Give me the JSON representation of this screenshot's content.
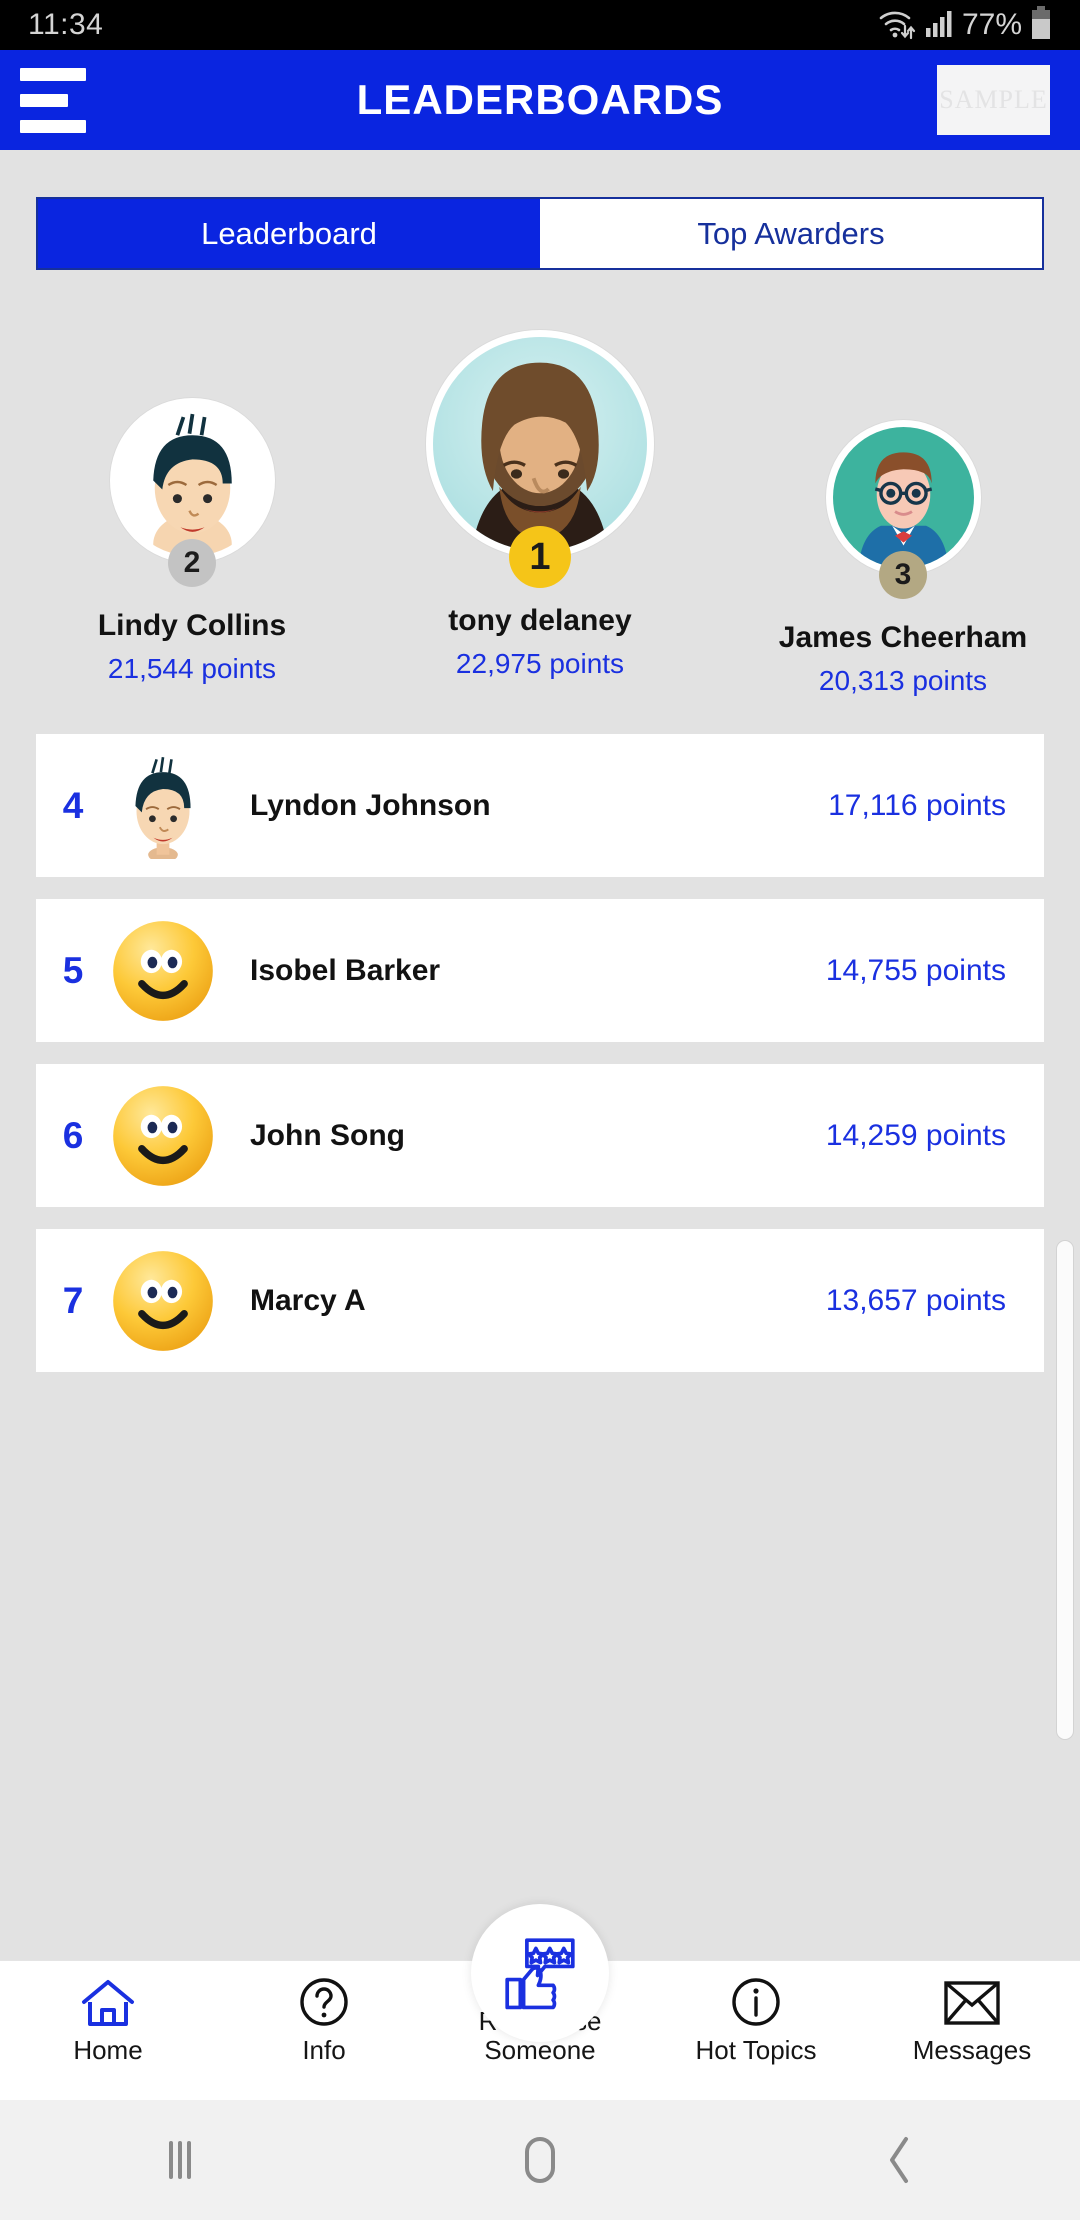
{
  "status_bar": {
    "time": "11:34",
    "battery_percent": "77%",
    "icons": [
      "wifi-icon",
      "signal-icon",
      "battery-icon"
    ]
  },
  "app_bar": {
    "menu_icon": "hamburger-menu-icon",
    "title": "LEADERBOARDS",
    "logo_text": "SAMPLE"
  },
  "tabs": {
    "items": [
      {
        "label": "Leaderboard",
        "active": true
      },
      {
        "label": "Top Awarders",
        "active": false
      }
    ]
  },
  "podium": [
    {
      "rank": "2",
      "name": "Lindy Collins",
      "points": "21,544 points",
      "medal_color": "#c3c3c3",
      "avatar": "male-avatar-dark-hair"
    },
    {
      "rank": "1",
      "name": "tony delaney",
      "points": "22,975 points",
      "medal_color": "#f5c518",
      "avatar": "photo-bearded-man"
    },
    {
      "rank": "3",
      "name": "James Cheerham",
      "points": "20,313 points",
      "medal_color": "#b3a883",
      "avatar": "male-avatar-glasses-bowtie"
    }
  ],
  "list": {
    "rows": [
      {
        "rank": "4",
        "name": "Lyndon Johnson",
        "points": "17,116 points",
        "avatar": "male-avatar-dark-hair"
      },
      {
        "rank": "5",
        "name": "Isobel Barker",
        "points": "14,755 points",
        "avatar": "smiley-face-icon"
      },
      {
        "rank": "6",
        "name": "John Song",
        "points": "14,259 points",
        "avatar": "smiley-face-icon"
      },
      {
        "rank": "7",
        "name": "Marcy A",
        "points": "13,657 points",
        "avatar": "smiley-face-icon"
      }
    ]
  },
  "bottom_nav": {
    "items": [
      {
        "label": "Home",
        "icon": "home-icon",
        "active": true
      },
      {
        "label": "Info",
        "icon": "question-mark-icon",
        "active": false
      },
      {
        "label": "Recognise\nSomeone",
        "label_line1": "Recognise",
        "label_line2": "Someone",
        "icon": "thumbs-up-stars-icon",
        "active": false
      },
      {
        "label": "Hot Topics",
        "icon": "info-circle-icon",
        "active": false
      },
      {
        "label": "Messages",
        "icon": "envelope-icon",
        "active": false
      }
    ]
  },
  "system_nav": {
    "buttons": [
      "recents-icon",
      "home-circle-icon",
      "back-chevron-icon"
    ]
  },
  "colors": {
    "brand_blue": "#0a25e0",
    "link_blue": "#1a30e0",
    "tab_border": "#16309c",
    "page_bg": "#e2e2e2",
    "gold": "#f5c518",
    "silver": "#c3c3c3",
    "bronze": "#b3a883"
  }
}
